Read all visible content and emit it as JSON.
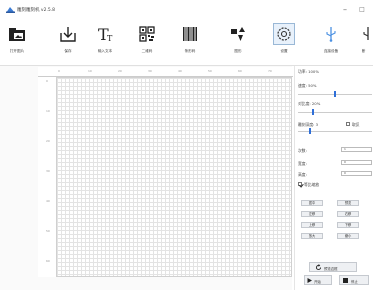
{
  "window": {
    "title": "雕刻雕刻机 v2.5.8",
    "minimize": "–",
    "maximize": "□"
  },
  "toolbar": {
    "items": [
      {
        "label": "打开图片",
        "icon": "folder-image-icon"
      },
      {
        "label": "保存",
        "icon": "save-icon"
      },
      {
        "label": "输入文本",
        "icon": "text-icon"
      },
      {
        "label": "二维码",
        "icon": "qrcode-icon"
      },
      {
        "label": "条形码",
        "icon": "barcode-icon"
      },
      {
        "label": "图形",
        "icon": "shapes-icon"
      },
      {
        "label": "设置",
        "icon": "gear-icon"
      },
      {
        "label": "连接设备",
        "icon": "usb-icon"
      },
      {
        "label": "断",
        "icon": "disconnect-icon"
      }
    ]
  },
  "panel": {
    "power_label": "功率: 100%",
    "speed_label": "速度: 50%",
    "speed_level": 0.5,
    "contrast_label": "对比度: 20%",
    "contrast_level": 0.2,
    "depth_label": "雕刻深度: 3",
    "depth_level": 0.15,
    "invert_label": "取反",
    "count_label": "次数:",
    "count_value": "1",
    "width_label": "宽度:",
    "width_value": "0",
    "height_label": "高度:",
    "height_value": "0",
    "lock_ratio_label": "等比缩放",
    "buttons": [
      "居中",
      "预览",
      "左移",
      "右移",
      "上移",
      "下移",
      "放大",
      "缩小"
    ],
    "preview_label": "预览边框",
    "start_label": "开始",
    "stop_label": "停止"
  },
  "colors": {
    "accent": "#2f6fd8",
    "panel_bg": "#ffffff",
    "grid_line": "#e3e3e3"
  }
}
